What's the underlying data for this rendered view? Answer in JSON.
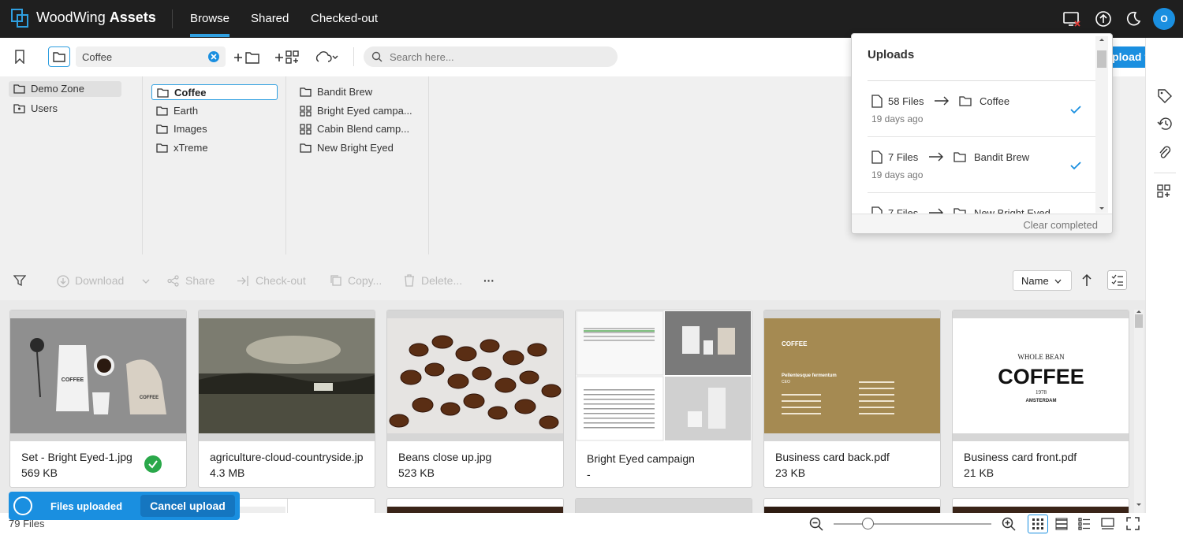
{
  "app": {
    "brand_light": "WoodWing ",
    "brand_bold": "Assets",
    "avatar_initial": "O",
    "accent": "#1a8fe0"
  },
  "nav": {
    "tabs": [
      {
        "label": "Browse",
        "active": true
      },
      {
        "label": "Shared"
      },
      {
        "label": "Checked-out"
      }
    ]
  },
  "toolbar": {
    "path": "Coffee",
    "search_placeholder": "Search here...",
    "upload_label": "Upload files"
  },
  "tree": {
    "col1": [
      "Demo Zone",
      "Users"
    ],
    "col2": [
      "Coffee",
      "Earth",
      "Images",
      "xTreme"
    ],
    "col3": [
      "Bandit Brew",
      "Bright Eyed campa...",
      "Cabin Blend camp...",
      "New Bright Eyed"
    ]
  },
  "actions": {
    "download": "Download",
    "share": "Share",
    "checkout": "Check-out",
    "copy": "Copy...",
    "delete": "Delete...",
    "more": "···",
    "sort": "Name"
  },
  "files": [
    {
      "name": "Set - Bright Eyed-1.jpg",
      "size": "569 KB",
      "uploaded": true
    },
    {
      "name": "agriculture-cloud-countryside.jpg",
      "size": "4.3 MB"
    },
    {
      "name": "Beans close up.jpg",
      "size": "523 KB"
    },
    {
      "name": "Bright Eyed campaign",
      "size": "-"
    },
    {
      "name": "Business card back.pdf",
      "size": "23 KB"
    },
    {
      "name": "Business card front.pdf",
      "size": "21 KB"
    }
  ],
  "status": {
    "file_count": "79 Files"
  },
  "toast": {
    "text": "Files uploaded",
    "cancel": "Cancel upload"
  },
  "uploads": {
    "title": "Uploads",
    "items": [
      {
        "count": "58 Files",
        "dest": "Coffee",
        "time": "19 days ago",
        "done": true
      },
      {
        "count": "7 Files",
        "dest": "Bandit Brew",
        "time": "19 days ago",
        "done": true
      },
      {
        "count": "7 Files",
        "dest": "New Bright Eyed",
        "time": "",
        "done": false
      }
    ],
    "clear": "Clear completed"
  },
  "thumb_text": {
    "coffee_word": "COFFEE",
    "whole_bean": "WHOLE BEAN",
    "year": "1978",
    "amsterdam": "AMSTERDAM",
    "card_sub": "Pellentesque fermentum",
    "card_role": "CEO"
  }
}
